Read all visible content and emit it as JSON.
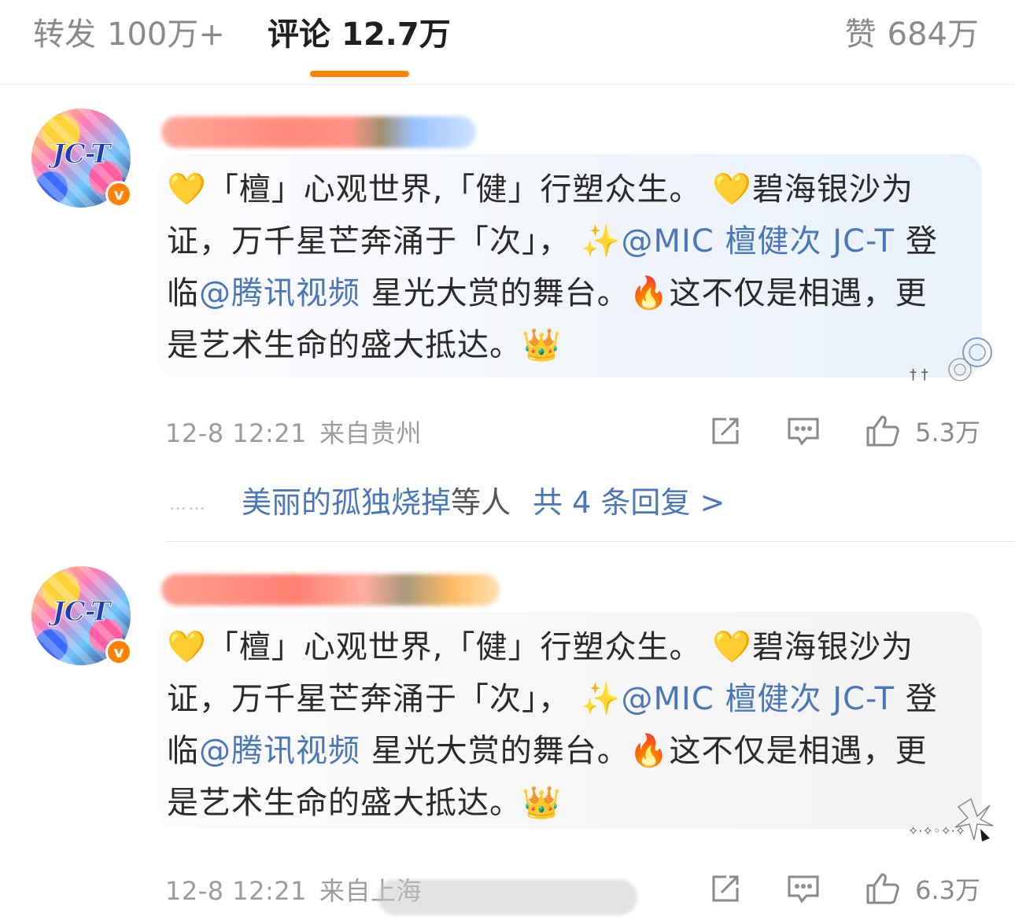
{
  "tabs": {
    "repost_label": "转发",
    "repost_count": "100万+",
    "comment_label": "评论",
    "comment_count": "12.7万",
    "like_label": "赞",
    "like_count": "684万"
  },
  "colors": {
    "accent": "#ff8200",
    "mention": "#4a77b8",
    "meta": "#9c9c9c"
  },
  "comments": [
    {
      "avatar_text": "JC-T",
      "verified_badge": "v",
      "text_parts": {
        "emoji_heart_1": "💛",
        "t1": "「檀」心观世界,「健」行塑众生。",
        "emoji_heart_2": "💛",
        "t2": "碧海银沙为证，万千星芒奔涌于「次」，",
        "emoji_sparkle": "✨",
        "mention_1": "@MIC 檀健次 JC-T",
        "t3": "登临",
        "mention_2": "@腾讯视频",
        "t4": "星光大赏的舞台。",
        "emoji_fire": "🔥",
        "t5": "这不仅是相遇，更是艺术生命的盛大抵达。",
        "emoji_crown": "👑"
      },
      "time": "12-8 12:21",
      "location": "来自贵州",
      "like_count": "5.3万",
      "replies": {
        "dots": "……",
        "first_replier": "美丽的孤独烧掉",
        "others": "等人",
        "total": "共 4 条回复 >"
      }
    },
    {
      "avatar_text": "JC-T",
      "verified_badge": "v",
      "text_parts": {
        "emoji_heart_1": "💛",
        "t1": "「檀」心观世界,「健」行塑众生。",
        "emoji_heart_2": "💛",
        "t2": "碧海银沙为证，万千星芒奔涌于「次」，",
        "emoji_sparkle": "✨",
        "mention_1": "@MIC 檀健次 JC-T",
        "t3": "登临",
        "mention_2": "@腾讯视频",
        "t4": " 星光大赏的舞台。",
        "emoji_fire": "🔥",
        "t5": "这不仅是相遇，更是艺术生命的盛大抵达。",
        "emoji_crown": "👑"
      },
      "time": "12-8 12:21",
      "location": "来自上海",
      "like_count": "6.3万"
    }
  ]
}
